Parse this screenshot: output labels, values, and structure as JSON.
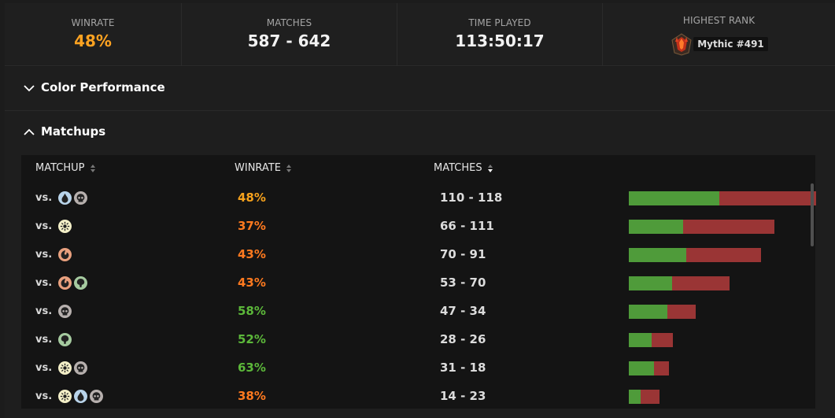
{
  "stats": {
    "winrate_label": "WINRATE",
    "winrate_value": "48%",
    "matches_label": "MATCHES",
    "matches_value": "587 - 642",
    "time_label": "TIME PLAYED",
    "time_value": "113:50:17",
    "rank_label": "HIGHEST RANK",
    "rank_value": "Mythic #491"
  },
  "sections": {
    "color_performance": "Color Performance",
    "matchups": "Matchups"
  },
  "table": {
    "columns": [
      "MATCHUP",
      "WINRATE",
      "MATCHES"
    ],
    "vs_label": "vs.",
    "rows": [
      {
        "colors": [
          "U",
          "B"
        ],
        "winrate": "48%",
        "matches": "110 - 118",
        "wins": 110,
        "losses": 118
      },
      {
        "colors": [
          "W"
        ],
        "winrate": "37%",
        "matches": "66 - 111",
        "wins": 66,
        "losses": 111
      },
      {
        "colors": [
          "R"
        ],
        "winrate": "43%",
        "matches": "70 - 91",
        "wins": 70,
        "losses": 91
      },
      {
        "colors": [
          "R",
          "G"
        ],
        "winrate": "43%",
        "matches": "53 - 70",
        "wins": 53,
        "losses": 70
      },
      {
        "colors": [
          "B"
        ],
        "winrate": "58%",
        "matches": "47 - 34",
        "wins": 47,
        "losses": 34
      },
      {
        "colors": [
          "G"
        ],
        "winrate": "52%",
        "matches": "28 - 26",
        "wins": 28,
        "losses": 26
      },
      {
        "colors": [
          "W",
          "B"
        ],
        "winrate": "63%",
        "matches": "31 - 18",
        "wins": 31,
        "losses": 18
      },
      {
        "colors": [
          "W",
          "U",
          "B"
        ],
        "winrate": "38%",
        "matches": "14 - 23",
        "wins": 14,
        "losses": 23
      }
    ]
  },
  "colors": {
    "winrate_high": "#5cb83a",
    "winrate_mid": "#f7a21c",
    "winrate_low": "#ff7a1f",
    "bar_win": "#4f9b3a",
    "bar_loss": "#9a3535"
  }
}
